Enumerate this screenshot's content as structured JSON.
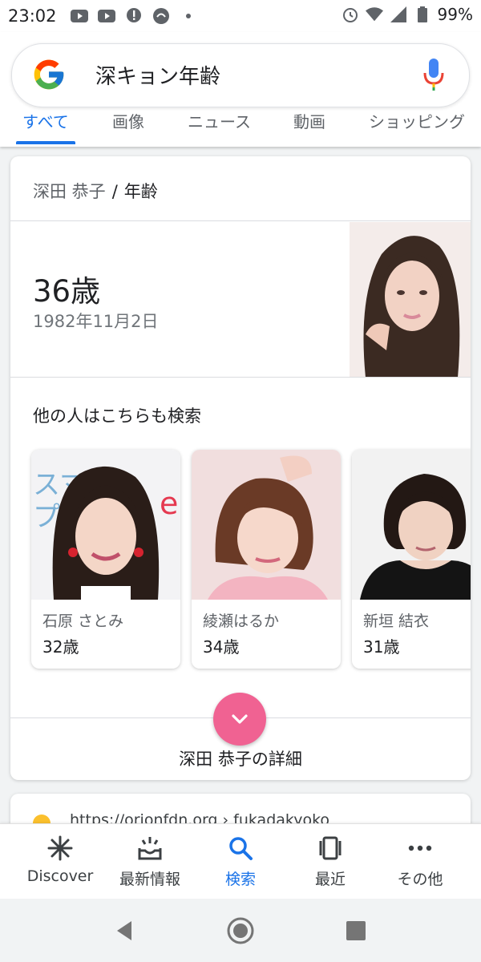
{
  "status": {
    "time": "23:02",
    "battery": "99%"
  },
  "search": {
    "query": "深キョン年齢"
  },
  "tabs": [
    {
      "label": "すべて"
    },
    {
      "label": "画像"
    },
    {
      "label": "ニュース"
    },
    {
      "label": "動画"
    },
    {
      "label": "ショッピング"
    }
  ],
  "result": {
    "breadcrumb_entity": "深田 恭子",
    "breadcrumb_sep": "/",
    "breadcrumb_attr": "年齢",
    "age": "36歳",
    "birthdate": "1982年11月2日",
    "also_search_title": "他の人はこちらも検索",
    "people": [
      {
        "name": "石原 さとみ",
        "age": "32歳"
      },
      {
        "name": "綾瀬はるか",
        "age": "34歳"
      },
      {
        "name": "新垣 結衣",
        "age": "31歳"
      }
    ],
    "details_label": "深田 恭子の詳細"
  },
  "next_result": {
    "url_text": "https://orionfdn.org › fukadakyoko"
  },
  "bottom_nav": [
    {
      "label": "Discover",
      "icon": "asterisk-icon"
    },
    {
      "label": "最新情報",
      "icon": "updates-tray-icon"
    },
    {
      "label": "検索",
      "icon": "search-icon"
    },
    {
      "label": "最近",
      "icon": "recent-cards-icon"
    },
    {
      "label": "その他",
      "icon": "more-dots-icon"
    }
  ],
  "colors": {
    "accent": "#1a73e8",
    "expand_button": "#f06292"
  }
}
